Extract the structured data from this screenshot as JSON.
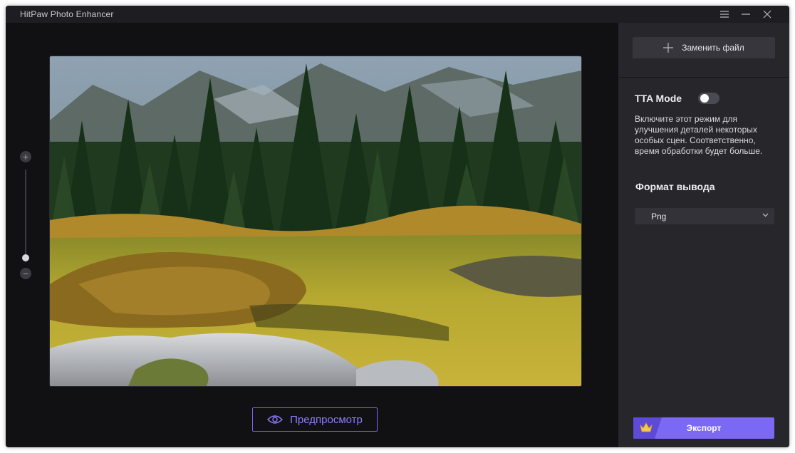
{
  "window": {
    "title": "HitPaw Photo Enhancer"
  },
  "titlebar": {
    "menu_icon": "hamburger-menu-icon",
    "minimize_icon": "minimize-icon",
    "close_icon": "close-icon"
  },
  "workspace": {
    "image_description": "preview",
    "zoom": {
      "plus_symbol": "+",
      "minus_symbol": "−",
      "level": 0.05
    },
    "preview_button": {
      "label": "Предпросмотр",
      "icon": "eye-icon"
    }
  },
  "sidebar": {
    "replace_button": {
      "label": "Заменить файл",
      "icon": "plus-icon"
    },
    "tta": {
      "label": "TTA Mode",
      "enabled": false,
      "description": "Включите этот режим для улучшения деталей некоторых особых сцен. Соответственно, время обработки будет больше."
    },
    "output_format": {
      "label": "Формат вывода",
      "selected": "Png"
    },
    "export_button": {
      "label": "Экспорт",
      "icon": "crown-icon"
    }
  },
  "colors": {
    "accent": "#7b68f5",
    "window_bg": "#111114",
    "sidebar_bg": "#26262b"
  }
}
